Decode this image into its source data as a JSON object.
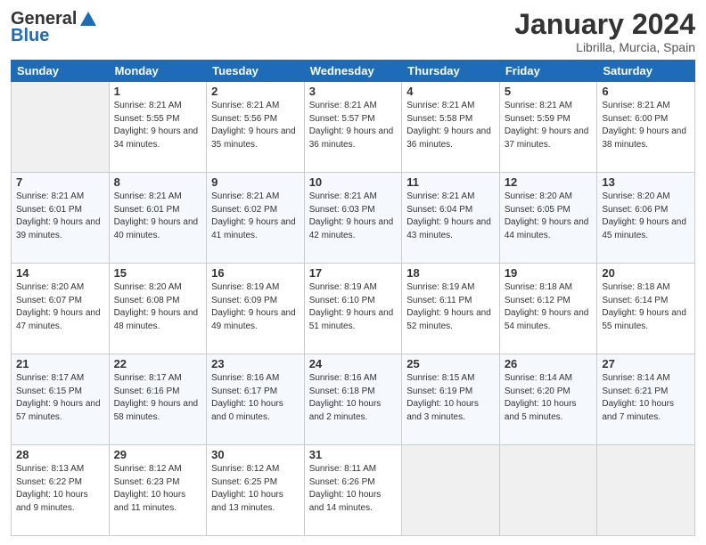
{
  "header": {
    "logo": {
      "line1": "General",
      "line2": "Blue"
    },
    "title": "January 2024",
    "location": "Librilla, Murcia, Spain"
  },
  "weekdays": [
    "Sunday",
    "Monday",
    "Tuesday",
    "Wednesday",
    "Thursday",
    "Friday",
    "Saturday"
  ],
  "weeks": [
    [
      {
        "day": "",
        "sunrise": "",
        "sunset": "",
        "daylight": ""
      },
      {
        "day": "1",
        "sunrise": "Sunrise: 8:21 AM",
        "sunset": "Sunset: 5:55 PM",
        "daylight": "Daylight: 9 hours and 34 minutes."
      },
      {
        "day": "2",
        "sunrise": "Sunrise: 8:21 AM",
        "sunset": "Sunset: 5:56 PM",
        "daylight": "Daylight: 9 hours and 35 minutes."
      },
      {
        "day": "3",
        "sunrise": "Sunrise: 8:21 AM",
        "sunset": "Sunset: 5:57 PM",
        "daylight": "Daylight: 9 hours and 36 minutes."
      },
      {
        "day": "4",
        "sunrise": "Sunrise: 8:21 AM",
        "sunset": "Sunset: 5:58 PM",
        "daylight": "Daylight: 9 hours and 36 minutes."
      },
      {
        "day": "5",
        "sunrise": "Sunrise: 8:21 AM",
        "sunset": "Sunset: 5:59 PM",
        "daylight": "Daylight: 9 hours and 37 minutes."
      },
      {
        "day": "6",
        "sunrise": "Sunrise: 8:21 AM",
        "sunset": "Sunset: 6:00 PM",
        "daylight": "Daylight: 9 hours and 38 minutes."
      }
    ],
    [
      {
        "day": "7",
        "sunrise": "Sunrise: 8:21 AM",
        "sunset": "Sunset: 6:01 PM",
        "daylight": "Daylight: 9 hours and 39 minutes."
      },
      {
        "day": "8",
        "sunrise": "Sunrise: 8:21 AM",
        "sunset": "Sunset: 6:01 PM",
        "daylight": "Daylight: 9 hours and 40 minutes."
      },
      {
        "day": "9",
        "sunrise": "Sunrise: 8:21 AM",
        "sunset": "Sunset: 6:02 PM",
        "daylight": "Daylight: 9 hours and 41 minutes."
      },
      {
        "day": "10",
        "sunrise": "Sunrise: 8:21 AM",
        "sunset": "Sunset: 6:03 PM",
        "daylight": "Daylight: 9 hours and 42 minutes."
      },
      {
        "day": "11",
        "sunrise": "Sunrise: 8:21 AM",
        "sunset": "Sunset: 6:04 PM",
        "daylight": "Daylight: 9 hours and 43 minutes."
      },
      {
        "day": "12",
        "sunrise": "Sunrise: 8:20 AM",
        "sunset": "Sunset: 6:05 PM",
        "daylight": "Daylight: 9 hours and 44 minutes."
      },
      {
        "day": "13",
        "sunrise": "Sunrise: 8:20 AM",
        "sunset": "Sunset: 6:06 PM",
        "daylight": "Daylight: 9 hours and 45 minutes."
      }
    ],
    [
      {
        "day": "14",
        "sunrise": "Sunrise: 8:20 AM",
        "sunset": "Sunset: 6:07 PM",
        "daylight": "Daylight: 9 hours and 47 minutes."
      },
      {
        "day": "15",
        "sunrise": "Sunrise: 8:20 AM",
        "sunset": "Sunset: 6:08 PM",
        "daylight": "Daylight: 9 hours and 48 minutes."
      },
      {
        "day": "16",
        "sunrise": "Sunrise: 8:19 AM",
        "sunset": "Sunset: 6:09 PM",
        "daylight": "Daylight: 9 hours and 49 minutes."
      },
      {
        "day": "17",
        "sunrise": "Sunrise: 8:19 AM",
        "sunset": "Sunset: 6:10 PM",
        "daylight": "Daylight: 9 hours and 51 minutes."
      },
      {
        "day": "18",
        "sunrise": "Sunrise: 8:19 AM",
        "sunset": "Sunset: 6:11 PM",
        "daylight": "Daylight: 9 hours and 52 minutes."
      },
      {
        "day": "19",
        "sunrise": "Sunrise: 8:18 AM",
        "sunset": "Sunset: 6:12 PM",
        "daylight": "Daylight: 9 hours and 54 minutes."
      },
      {
        "day": "20",
        "sunrise": "Sunrise: 8:18 AM",
        "sunset": "Sunset: 6:14 PM",
        "daylight": "Daylight: 9 hours and 55 minutes."
      }
    ],
    [
      {
        "day": "21",
        "sunrise": "Sunrise: 8:17 AM",
        "sunset": "Sunset: 6:15 PM",
        "daylight": "Daylight: 9 hours and 57 minutes."
      },
      {
        "day": "22",
        "sunrise": "Sunrise: 8:17 AM",
        "sunset": "Sunset: 6:16 PM",
        "daylight": "Daylight: 9 hours and 58 minutes."
      },
      {
        "day": "23",
        "sunrise": "Sunrise: 8:16 AM",
        "sunset": "Sunset: 6:17 PM",
        "daylight": "Daylight: 10 hours and 0 minutes."
      },
      {
        "day": "24",
        "sunrise": "Sunrise: 8:16 AM",
        "sunset": "Sunset: 6:18 PM",
        "daylight": "Daylight: 10 hours and 2 minutes."
      },
      {
        "day": "25",
        "sunrise": "Sunrise: 8:15 AM",
        "sunset": "Sunset: 6:19 PM",
        "daylight": "Daylight: 10 hours and 3 minutes."
      },
      {
        "day": "26",
        "sunrise": "Sunrise: 8:14 AM",
        "sunset": "Sunset: 6:20 PM",
        "daylight": "Daylight: 10 hours and 5 minutes."
      },
      {
        "day": "27",
        "sunrise": "Sunrise: 8:14 AM",
        "sunset": "Sunset: 6:21 PM",
        "daylight": "Daylight: 10 hours and 7 minutes."
      }
    ],
    [
      {
        "day": "28",
        "sunrise": "Sunrise: 8:13 AM",
        "sunset": "Sunset: 6:22 PM",
        "daylight": "Daylight: 10 hours and 9 minutes."
      },
      {
        "day": "29",
        "sunrise": "Sunrise: 8:12 AM",
        "sunset": "Sunset: 6:23 PM",
        "daylight": "Daylight: 10 hours and 11 minutes."
      },
      {
        "day": "30",
        "sunrise": "Sunrise: 8:12 AM",
        "sunset": "Sunset: 6:25 PM",
        "daylight": "Daylight: 10 hours and 13 minutes."
      },
      {
        "day": "31",
        "sunrise": "Sunrise: 8:11 AM",
        "sunset": "Sunset: 6:26 PM",
        "daylight": "Daylight: 10 hours and 14 minutes."
      },
      {
        "day": "",
        "sunrise": "",
        "sunset": "",
        "daylight": ""
      },
      {
        "day": "",
        "sunrise": "",
        "sunset": "",
        "daylight": ""
      },
      {
        "day": "",
        "sunrise": "",
        "sunset": "",
        "daylight": ""
      }
    ]
  ]
}
